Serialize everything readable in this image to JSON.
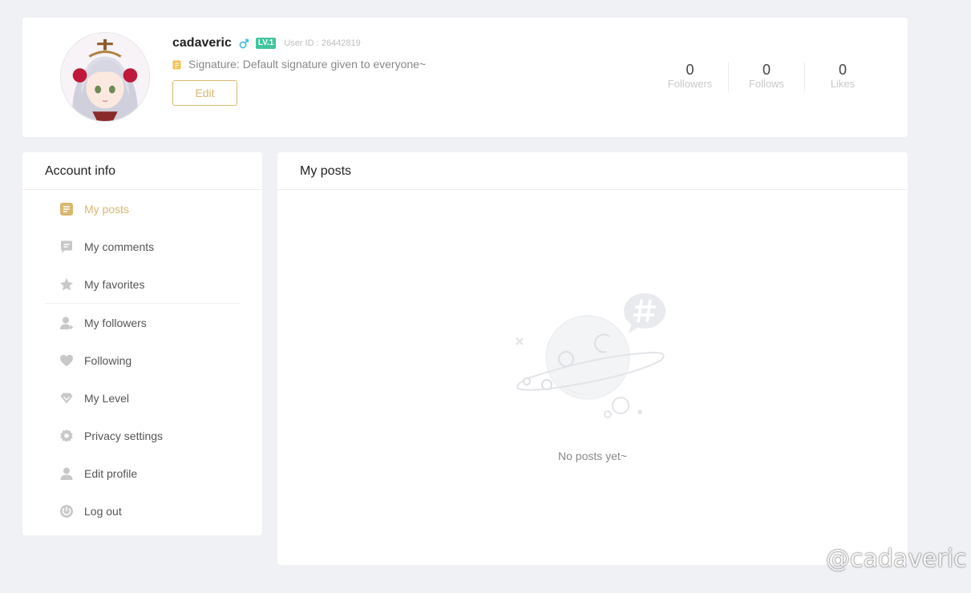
{
  "profile": {
    "username": "cadaveric",
    "gender_icon": "male-icon",
    "level": "LV.1",
    "user_id": "User ID : 26442819",
    "signature": "Signature: Default signature given to everyone~",
    "edit_label": "Edit",
    "stats": [
      {
        "value": "0",
        "label": "Followers"
      },
      {
        "value": "0",
        "label": "Follows"
      },
      {
        "value": "0",
        "label": "Likes"
      }
    ]
  },
  "sidebar": {
    "title": "Account info",
    "items": [
      {
        "label": "My posts",
        "icon": "posts-icon",
        "active": true
      },
      {
        "label": "My comments",
        "icon": "comment-icon"
      },
      {
        "label": "My favorites",
        "icon": "star-icon"
      },
      {
        "label": "My followers",
        "icon": "user-plus-icon"
      },
      {
        "label": "Following",
        "icon": "heart-icon"
      },
      {
        "label": "My Level",
        "icon": "diamond-icon"
      },
      {
        "label": "Privacy settings",
        "icon": "gear-icon"
      },
      {
        "label": "Edit profile",
        "icon": "user-icon"
      },
      {
        "label": "Log out",
        "icon": "power-icon"
      }
    ]
  },
  "main": {
    "title": "My posts",
    "empty_text": "No posts yet~"
  },
  "watermark": "@cadaveric",
  "colors": {
    "accent": "#d9b770",
    "level_badge": "#43c59e",
    "gender": "#3fb9ea",
    "background": "#f0f1f5",
    "icon_gray": "#c8c8c8"
  }
}
